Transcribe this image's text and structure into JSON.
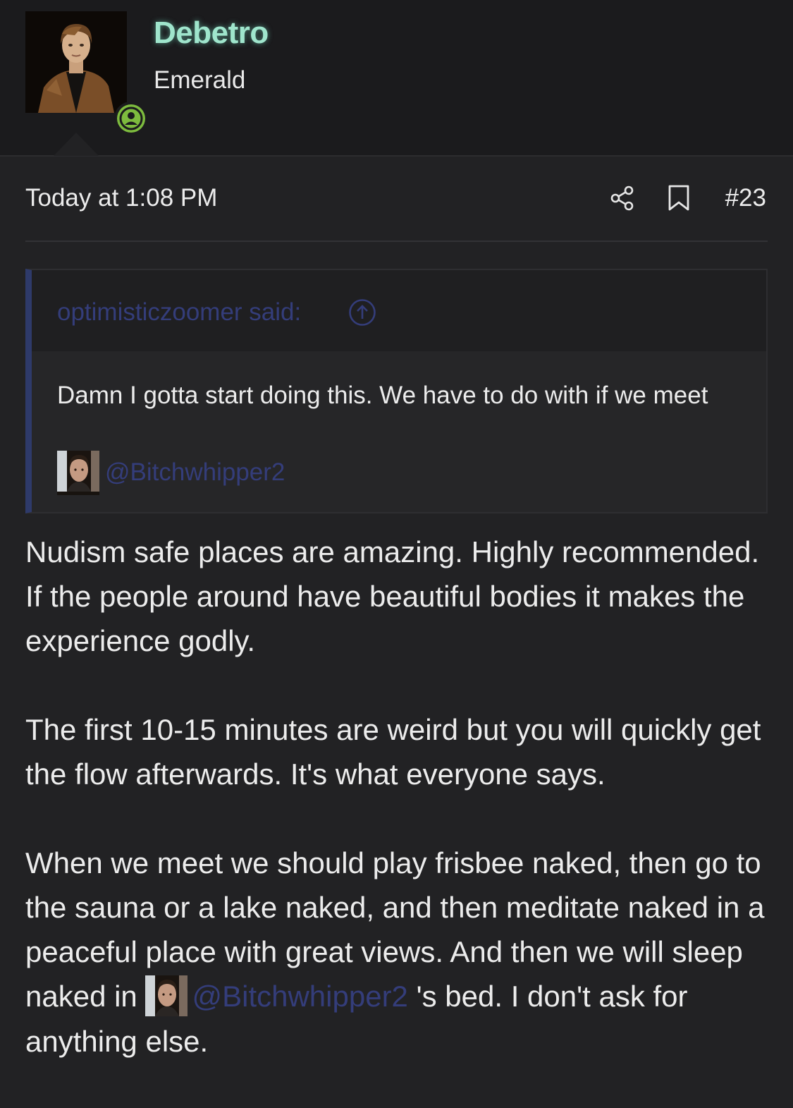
{
  "user": {
    "name": "Debetro",
    "title": "Emerald",
    "avatar_icon": "user-avatar-photo",
    "status_icon": "online-user-icon",
    "name_color": "#9fe5cc",
    "status_color": "#7dbb3e"
  },
  "post": {
    "timestamp": "Today at 1:08 PM",
    "number": "#23",
    "share_icon": "share-icon",
    "bookmark_icon": "bookmark-icon"
  },
  "quote": {
    "author_said": "optimisticzoomer said:",
    "jump_icon": "arrow-up-circle-icon",
    "text": "Damn I gotta start doing this. We have to do with if we meet",
    "mention": "@Bitchwhipper2",
    "accent_color": "#2e3a6a"
  },
  "body": {
    "paragraph_1": "Nudism safe places are amazing. Highly recommended. If the people around have beautiful bodies it makes the experience godly.",
    "paragraph_2": "The first 10-15 minutes are weird but you will quickly get the flow afterwards. It's what everyone says.",
    "paragraph_3_before": "When we meet we should play frisbee naked, then go to the sauna or a lake naked, and then meditate naked in a peaceful place with great views. And then we will sleep naked in",
    "paragraph_3_mention": "@Bitchwhipper2",
    "paragraph_3_after": " 's bed. I don't ask for anything else."
  }
}
